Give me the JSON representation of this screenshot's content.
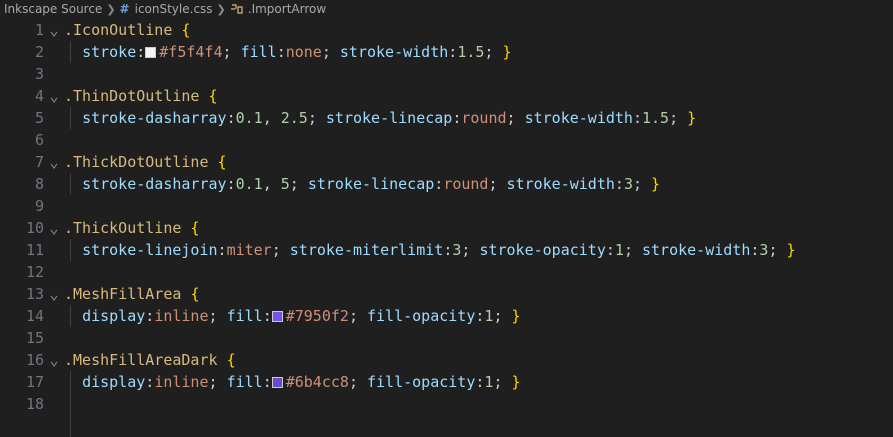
{
  "breadcrumb": {
    "folder": "Inkscape Source",
    "file": "iconStyle.css",
    "symbol": ".ImportArrow"
  },
  "colors": {
    "background": "#1f1f1f",
    "swatch_1": "#f5f4f4",
    "swatch_2": "#7950f2",
    "swatch_3": "#6b4cc8"
  },
  "lines": [
    {
      "n": "1",
      "selector": ".IconOutline",
      "brace": "{"
    },
    {
      "n": "2",
      "p1": "stroke",
      "c1": ":",
      "hex1": "#f5f4f4",
      "s1": ";",
      "p2": "fill",
      "c2": ":",
      "v2": "none",
      "s2": ";",
      "p3": "stroke-width",
      "c3": ":",
      "v3": "1.5",
      "s3": ";",
      "close": "}"
    },
    {
      "n": "3"
    },
    {
      "n": "4",
      "selector": ".ThinDotOutline",
      "brace": "{"
    },
    {
      "n": "5",
      "p1": "stroke-dasharray",
      "c1": ":",
      "v1a": "0.1",
      "comma": ",",
      "v1b": "2.5",
      "s1": ";",
      "p2": "stroke-linecap",
      "c2": ":",
      "v2": "round",
      "s2": ";",
      "p3": "stroke-width",
      "c3": ":",
      "v3": "1.5",
      "s3": ";",
      "close": "}"
    },
    {
      "n": "6"
    },
    {
      "n": "7",
      "selector": ".ThickDotOutline",
      "brace": "{"
    },
    {
      "n": "8",
      "p1": "stroke-dasharray",
      "c1": ":",
      "v1a": "0.1",
      "comma": ",",
      "v1b": "5",
      "s1": ";",
      "p2": "stroke-linecap",
      "c2": ":",
      "v2": "round",
      "s2": ";",
      "p3": "stroke-width",
      "c3": ":",
      "v3": "3",
      "s3": ";",
      "close": "}"
    },
    {
      "n": "9"
    },
    {
      "n": "10",
      "selector": ".ThickOutline",
      "brace": "{"
    },
    {
      "n": "11",
      "p1": "stroke-linejoin",
      "c1": ":",
      "v1": "miter",
      "s1": ";",
      "p2": "stroke-miterlimit",
      "c2": ":",
      "v2": "3",
      "s2": ";",
      "p3": "stroke-opacity",
      "c3": ":",
      "v3": "1",
      "s3": ";",
      "p4": "stroke-width",
      "c4": ":",
      "v4": "3",
      "s4": ";",
      "close": "}"
    },
    {
      "n": "12"
    },
    {
      "n": "13",
      "selector": ".MeshFillArea",
      "brace": "{"
    },
    {
      "n": "14",
      "p1": "display",
      "c1": ":",
      "v1": "inline",
      "s1": ";",
      "p2": "fill",
      "c2": ":",
      "hex2": "#7950f2",
      "s2": ";",
      "p3": "fill-opacity",
      "c3": ":",
      "v3": "1",
      "s3": ";",
      "close": "}"
    },
    {
      "n": "15"
    },
    {
      "n": "16",
      "selector": ".MeshFillAreaDark",
      "brace": "{"
    },
    {
      "n": "17",
      "p1": "display",
      "c1": ":",
      "v1": "inline",
      "s1": ";",
      "p2": "fill",
      "c2": ":",
      "hex2": "#6b4cc8",
      "s2": ";",
      "p3": "fill-opacity",
      "c3": ":",
      "v3": "1",
      "s3": ";",
      "close": "}"
    },
    {
      "n": "18"
    }
  ]
}
